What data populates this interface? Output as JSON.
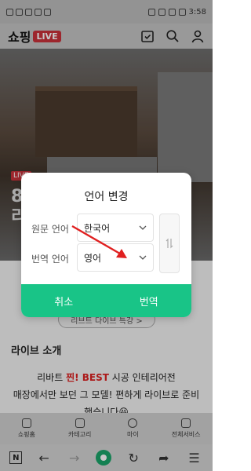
{
  "status_bar": {
    "time": "3:58"
  },
  "header": {
    "logo_text": "쇼핑",
    "logo_badge": "LIVE"
  },
  "hero": {
    "badge": "LIVE",
    "title_line1": "8",
    "title_line2": "리"
  },
  "content": {
    "more_link": "리브트 다이브 특강 >",
    "section_title": "라이브 소개",
    "desc_line1_pre": "리바트 ",
    "desc_line1_red": "찐! BEST",
    "desc_line1_post": " 시공 인테리어전",
    "desc_line2": "매장에서만 보던 그 모델! 편하게 라이브로 준비",
    "desc_line3": "했습니다😆"
  },
  "modal": {
    "title": "언어 변경",
    "source_label": "원문 언어",
    "source_value": "한국어",
    "target_label": "번역 언어",
    "target_value": "영어",
    "cancel_label": "취소",
    "translate_label": "번역"
  },
  "bottom_nav": {
    "items": [
      {
        "label": "쇼핑홈",
        "icon": "shopping-home-icon"
      },
      {
        "label": "카테고리",
        "icon": "menu-icon"
      },
      {
        "label": "마이",
        "icon": "person-icon"
      },
      {
        "label": "전체서비스",
        "icon": "grid-icon"
      }
    ]
  },
  "colors": {
    "accent_green": "#19c487",
    "brand_red": "#c9313a",
    "annotation_red": "#e02020"
  }
}
